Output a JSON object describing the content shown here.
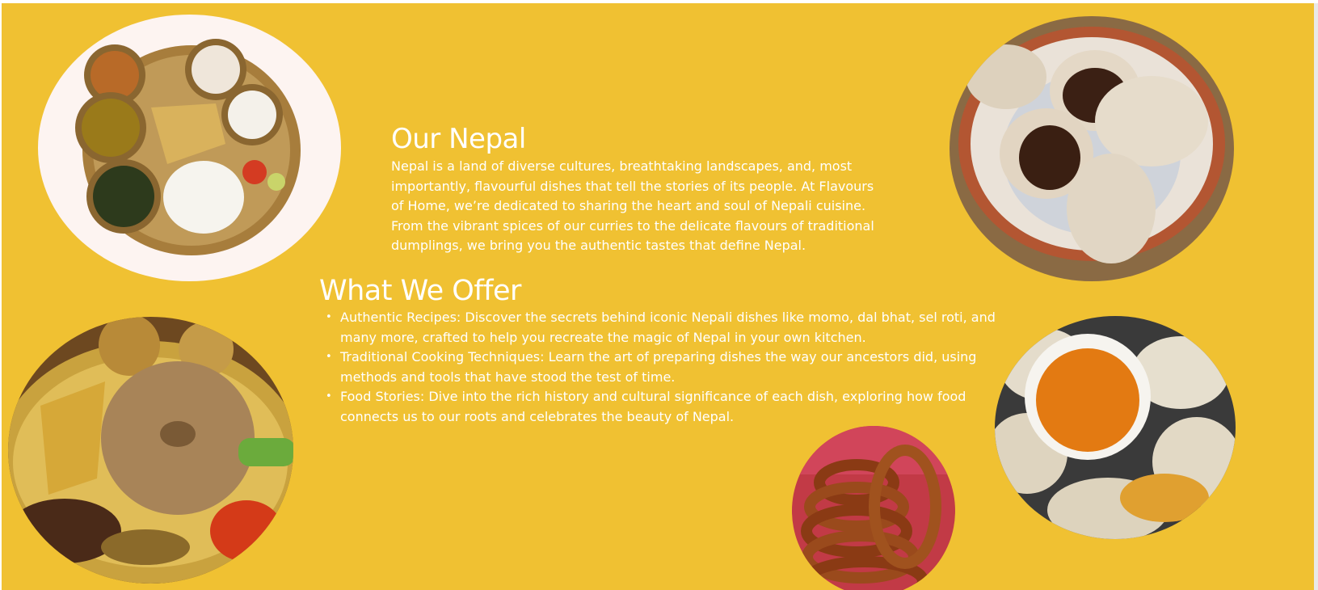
{
  "about": {
    "title": "Our Nepal",
    "paragraph": "Nepal is a land of diverse cultures, breathtaking landscapes, and, most importantly, flavourful dishes that tell the stories of its people. At Flavours of Home, we’re dedicated to sharing the heart and soul of Nepali cuisine. From the vibrant spices of our curries to the delicate flavours of traditional dumplings, we bring you the authentic tastes that define Nepal."
  },
  "offer": {
    "title": "What We Offer",
    "items": [
      {
        "text": "Authentic Recipes: Discover the secrets behind iconic Nepali dishes like momo, dal bhat, sel roti, and many more, crafted to help you recreate the magic of Nepal in your own kitchen."
      },
      {
        "text": "Traditional Cooking Techniques: Learn the art of preparing dishes the way our ancestors did, using methods and tools that have stood the test of time."
      },
      {
        "text": "Food Stories: Dive into the rich history and cultural significance of each dish, exploring how food connects us to our roots and celebrates the beauty of Nepal."
      }
    ]
  },
  "colors": {
    "background": "#f0c132",
    "text": "#ffffff"
  },
  "images": [
    {
      "name": "dal-bhat-thali-image"
    },
    {
      "name": "filled-momo-plate-image"
    },
    {
      "name": "dhido-platter-image"
    },
    {
      "name": "momo-with-achar-image"
    },
    {
      "name": "sel-roti-image"
    }
  ]
}
